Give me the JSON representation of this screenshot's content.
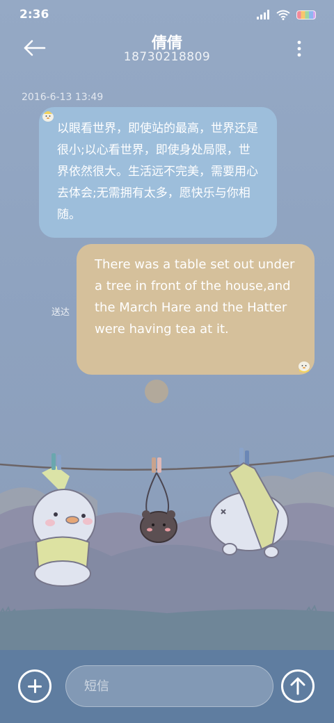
{
  "status": {
    "time": "2:36"
  },
  "header": {
    "contact_name": "倩倩",
    "phone_number": "18730218809"
  },
  "thread": {
    "timestamp": "2016-6-13 13:49",
    "messages": [
      {
        "direction": "incoming",
        "text": "以眼看世界，即使站的最高，世界还是很小;以心看世界，即使身处局限，世界依然很大。生活远不完美，需要用心去体会;无需拥有太多，愿快乐与你相随。"
      },
      {
        "direction": "outgoing",
        "text": "There was a table set out under a tree in front of the house,and the March Hare and the Hatter were having tea at it.",
        "status": "送达"
      }
    ]
  },
  "composer": {
    "placeholder": "短信"
  },
  "colors": {
    "incoming_bubble": "#9dbedb",
    "outgoing_bubble": "#d5c09b",
    "bottom_bar": "#5f7da0"
  }
}
